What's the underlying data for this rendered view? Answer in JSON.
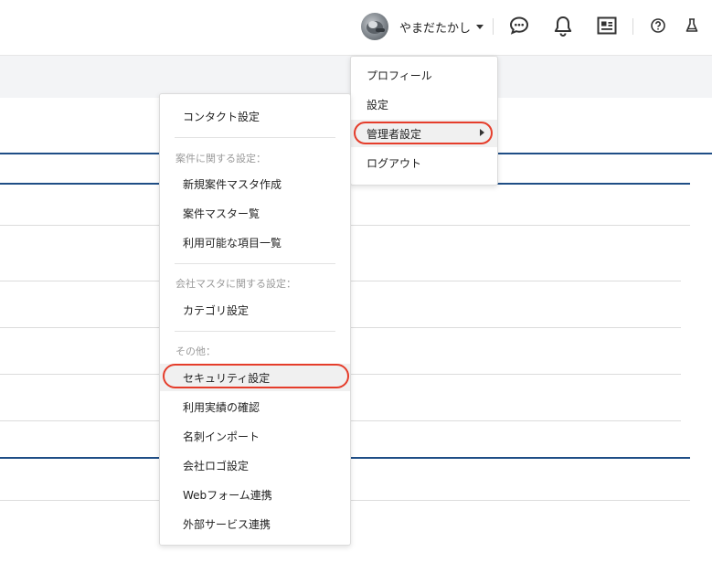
{
  "header": {
    "username": "やまだたかし",
    "icons": [
      "chat-bubble-icon",
      "bell-icon",
      "id-card-icon",
      "help-circle-icon",
      "flask-icon"
    ]
  },
  "user_menu": {
    "items": [
      {
        "label": "プロフィール"
      },
      {
        "label": "設定"
      },
      {
        "label": "管理者設定",
        "has_submenu": true,
        "highlighted": true
      },
      {
        "label": "ログアウト"
      }
    ]
  },
  "admin_menu": {
    "contact_settings": "コンタクト設定",
    "sections": [
      {
        "heading": "案件に関する設定：",
        "items": [
          "新規案件マスタ作成",
          "案件マスター覧",
          "利用可能な項目一覧"
        ]
      },
      {
        "heading": "会社マスタに関する設定：",
        "items": [
          "カテゴリ設定"
        ]
      },
      {
        "heading": "その他：",
        "items": [
          "セキュリティ設定",
          "利用実績の確認",
          "名刺インポート",
          "会社ロゴ設定",
          "Webフォーム連携",
          "外部サービス連携"
        ]
      }
    ],
    "highlighted_item": "セキュリティ設定"
  },
  "colors": {
    "accent_blue": "#1f4e86",
    "highlight_ring": "#e53d2b",
    "band": "#f3f4f6"
  }
}
